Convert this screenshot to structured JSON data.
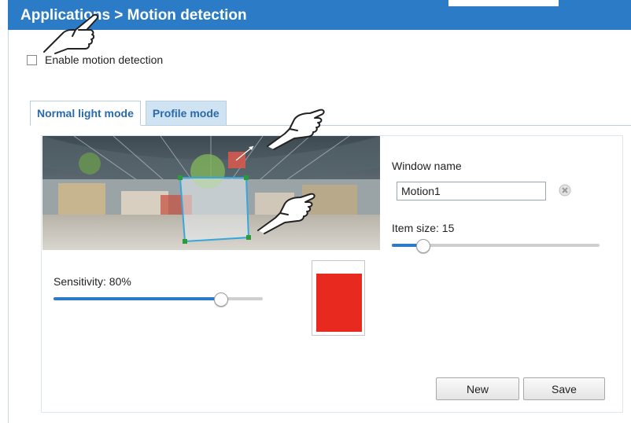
{
  "header": {
    "title": "Applications  > Motion detection"
  },
  "enable": {
    "label": "Enable motion detection",
    "checked": false
  },
  "tabs": [
    {
      "label": "Normal light mode",
      "active": true
    },
    {
      "label": "Profile mode",
      "active": false
    }
  ],
  "window": {
    "label": "Window name",
    "value": "Motion1"
  },
  "item_size": {
    "label": "Item size: 15",
    "level": 0.15
  },
  "sensitivity": {
    "label": "Sensitivity: 80%",
    "level": 0.8
  },
  "indicator": {
    "color": "#e8291f"
  },
  "buttons": {
    "new": "New",
    "save": "Save"
  },
  "colors": {
    "header": "#2c7bc6",
    "tab_text": "#2a6aa8",
    "tab_inactive_bg": "#cfe3f3",
    "slider_fill": "#2c7bc6"
  }
}
